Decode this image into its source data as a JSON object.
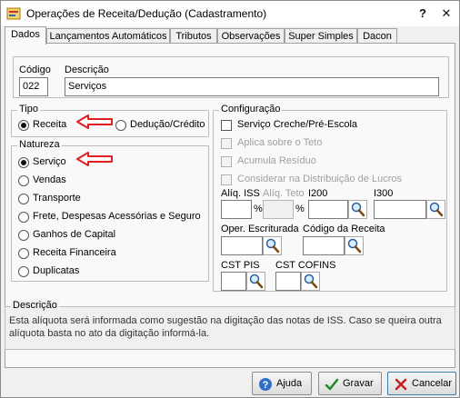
{
  "window": {
    "title": "Operações de Receita/Dedução (Cadastramento)",
    "help": "?",
    "close": "✕"
  },
  "tabs": [
    {
      "label": "Dados",
      "active": true
    },
    {
      "label": "Lançamentos Automáticos",
      "active": false
    },
    {
      "label": "Tributos",
      "active": false
    },
    {
      "label": "Observações",
      "active": false
    },
    {
      "label": "Super Simples",
      "active": false
    },
    {
      "label": "Dacon",
      "active": false
    }
  ],
  "dados": {
    "codigo_label": "Código",
    "codigo_value": "022",
    "descricao_label": "Descrição",
    "descricao_value": "Serviços"
  },
  "tipo": {
    "legend": "Tipo",
    "options": [
      {
        "label": "Receita",
        "checked": true
      },
      {
        "label": "Dedução/Crédito",
        "checked": false
      }
    ]
  },
  "natureza": {
    "legend": "Natureza",
    "options": [
      {
        "label": "Serviço",
        "checked": true
      },
      {
        "label": "Vendas",
        "checked": false
      },
      {
        "label": "Transporte",
        "checked": false
      },
      {
        "label": "Frete, Despesas Acessórias e Seguro",
        "checked": false
      },
      {
        "label": "Ganhos de Capital",
        "checked": false
      },
      {
        "label": "Receita Financeira",
        "checked": false
      },
      {
        "label": "Duplicatas",
        "checked": false
      }
    ]
  },
  "configuracao": {
    "legend": "Configuração",
    "checkboxes": [
      {
        "label": "Serviço Creche/Pré-Escola",
        "enabled": true,
        "checked": false
      },
      {
        "label": "Aplica sobre o Teto",
        "enabled": false,
        "checked": false
      },
      {
        "label": "Acumula Resíduo",
        "enabled": false,
        "checked": false
      },
      {
        "label": "Considerar na Distribuição de Lucros",
        "enabled": false,
        "checked": false
      }
    ],
    "aliq_iss_label": "Alíq. ISS",
    "aliq_iss_value": "",
    "aliq_teto_label": "Alíq. Teto",
    "aliq_teto_value": "",
    "i200_label": "I200",
    "i200_value": "",
    "i300_label": "I300",
    "i300_value": "",
    "percent": "%",
    "oper_escrituracao_label": "Oper. Escriturada",
    "oper_escrituracao_value": "",
    "codigo_receita_label": "Código da Receita",
    "codigo_receita_value": "",
    "cst_pis_label": "CST PIS",
    "cst_pis_value": "",
    "cst_cofins_label": "CST COFINS",
    "cst_cofins_value": ""
  },
  "descricao_box": {
    "legend": "Descrição",
    "text": "Esta alíquota será informada como sugestão na digitação das notas  de ISS.  Caso se queira outra alíquota basta no ato da digitação informá-la."
  },
  "buttons": {
    "ajuda": "Ajuda",
    "gravar": "Gravar",
    "cancelar": "Cancelar"
  },
  "colors": {
    "annotation_arrow": "#e02020",
    "window_bg": "#f0f0f0",
    "tab_body_bg": "#f9f9f9"
  },
  "icons": [
    "app-icon",
    "help-icon",
    "close-icon",
    "magnifier-icon",
    "check-icon",
    "cancel-icon",
    "question-icon"
  ]
}
